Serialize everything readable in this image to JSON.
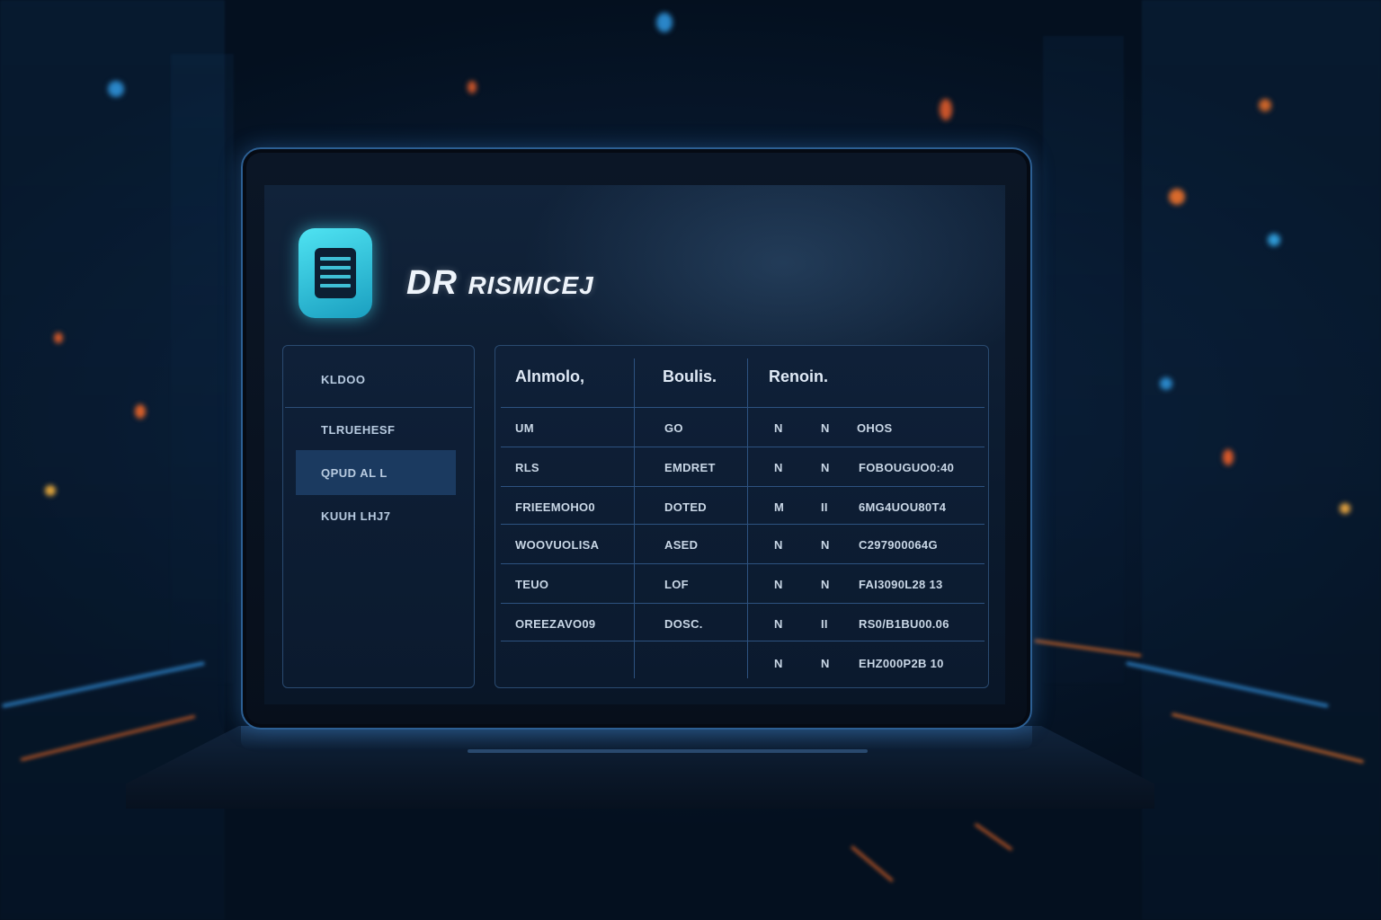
{
  "app": {
    "title_main": "DR",
    "title_rest": "RISMICEJ"
  },
  "sidebar": {
    "items": [
      {
        "label": "KLDOO"
      },
      {
        "label": "TLRUEHESF"
      },
      {
        "label": "QPUD AL L"
      },
      {
        "label": "KUUH LHJ7"
      }
    ],
    "active_index": 2
  },
  "table": {
    "headers": [
      "Alnmolo,",
      "Boulis.",
      "Renoin."
    ],
    "rows": [
      {
        "c1": "UM",
        "c2": "GO",
        "c3": "N",
        "c4": "N",
        "c5": "OHOS"
      },
      {
        "c1": "RLS",
        "c2": "EMDRET",
        "c3": "N",
        "c4": "N",
        "c5": "FOBOUGUO0:40"
      },
      {
        "c1": "FRIEEMOHO0",
        "c2": "DOTED",
        "c3": "M",
        "c4": "II",
        "c5": "6MG4UOU80T4"
      },
      {
        "c1": "WOOVUOLISA",
        "c2": "ASED",
        "c3": "N",
        "c4": "N",
        "c5": "C297900064G"
      },
      {
        "c1": "TEUO",
        "c2": "LOF",
        "c3": "N",
        "c4": "N",
        "c5": "FAI3090L28 13"
      },
      {
        "c1": "OREEZAVO09",
        "c2": "DOSC.",
        "c3": "N",
        "c4": "II",
        "c5": "RS0/B1BU00.06"
      },
      {
        "c1": "",
        "c2": "",
        "c3": "N",
        "c4": "N",
        "c5": "EHZ000P2B 10"
      }
    ]
  },
  "colors": {
    "accent": "#3fd3e8",
    "panel_border": "#2a4a70",
    "active_item": "#1b3a60"
  }
}
